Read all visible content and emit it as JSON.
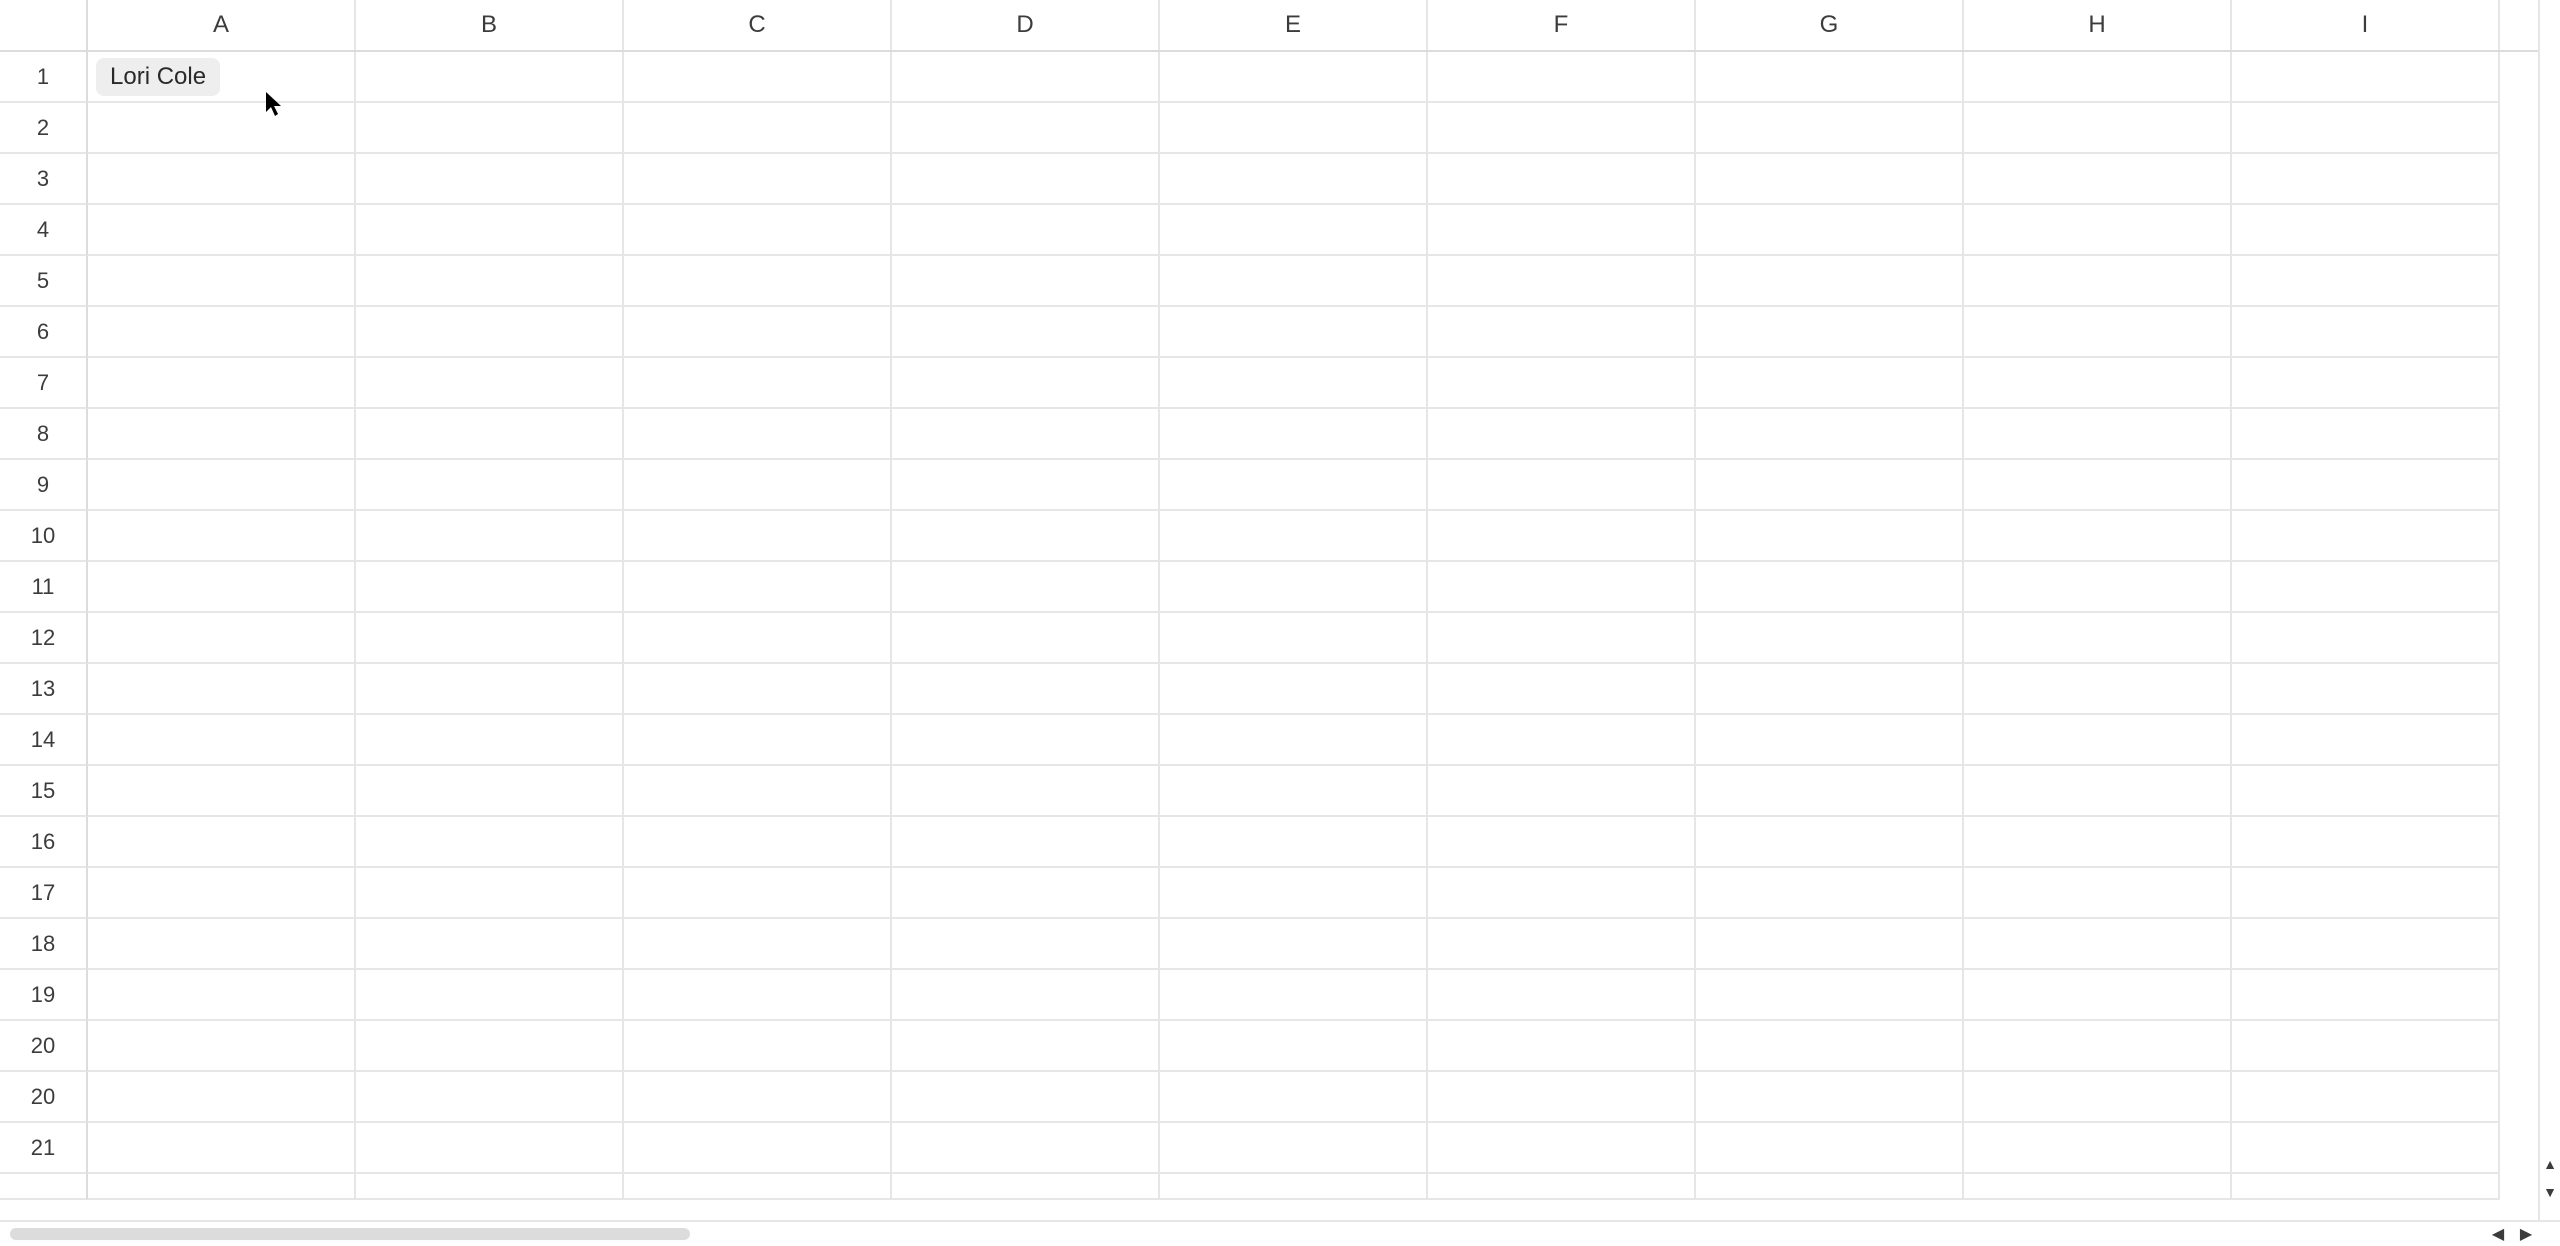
{
  "columns": [
    "A",
    "B",
    "C",
    "D",
    "E",
    "F",
    "G",
    "H",
    "I"
  ],
  "rows": [
    "1",
    "2",
    "3",
    "4",
    "5",
    "6",
    "7",
    "8",
    "9",
    "10",
    "11",
    "12",
    "13",
    "14",
    "15",
    "16",
    "17",
    "18",
    "19",
    "20",
    "20",
    "21"
  ],
  "cells": {
    "A1": {
      "chip_text": "Lori Cole"
    }
  },
  "hscroll": {
    "left_arrow": "◀",
    "right_arrow": "▶"
  },
  "vscroll": {
    "up_arrow": "▲",
    "down_arrow": "▼"
  }
}
